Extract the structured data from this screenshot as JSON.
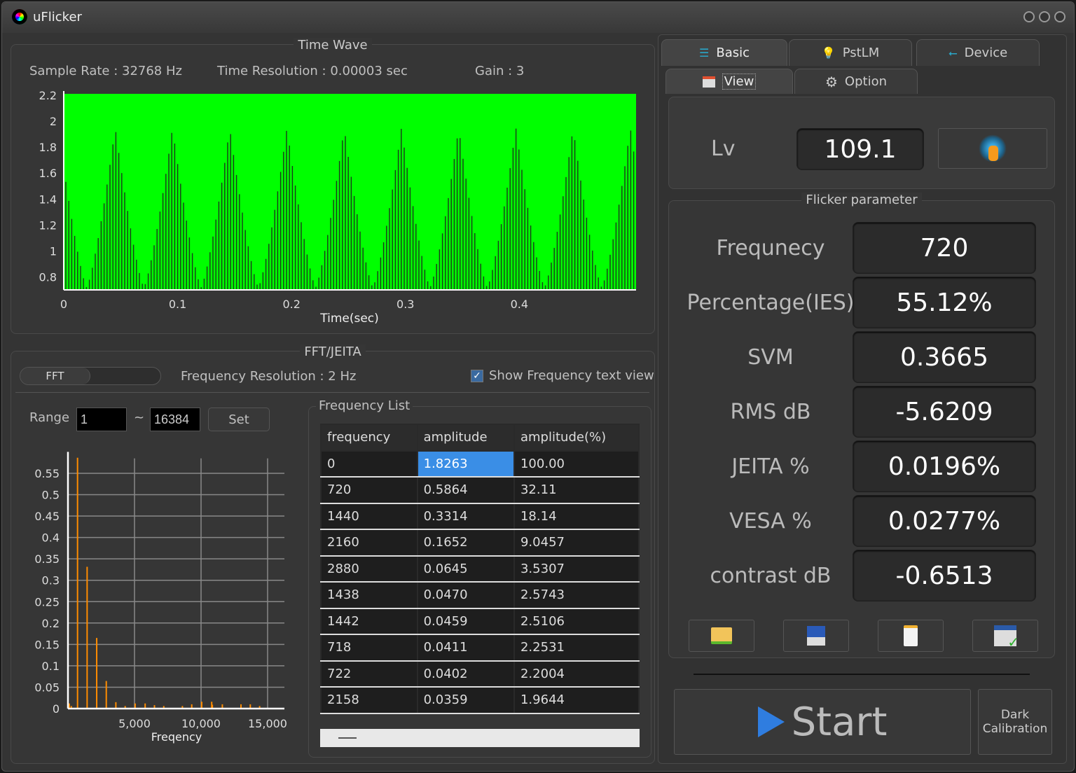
{
  "app": {
    "title": "uFlicker"
  },
  "time_wave": {
    "title": "Time Wave",
    "sample_rate": "Sample Rate : 32768 Hz",
    "time_resolution": "Time Resolution : 0.00003 sec",
    "gain": "Gain : 3"
  },
  "chart_data": [
    {
      "type": "area",
      "xlabel": "Time(sec)",
      "ylabel": "",
      "x_ticks": [
        "0",
        "0.1",
        "0.2",
        "0.3",
        "0.4"
      ],
      "y_ticks": [
        "0.8",
        "1",
        "1.2",
        "1.4",
        "1.6",
        "1.8",
        "2",
        "2.2"
      ],
      "xlim": [
        0,
        0.5
      ],
      "ylim": [
        0.7,
        2.2
      ],
      "color": "#00ff00",
      "envelope_peaks_x": [
        0.045,
        0.095,
        0.145,
        0.195,
        0.245,
        0.295,
        0.345,
        0.395,
        0.445,
        0.495
      ],
      "peak_y": 1.95,
      "max_y": 2.2,
      "min_y": 0.72
    },
    {
      "type": "bar",
      "xlabel": "Freqency",
      "ylabel": "",
      "x_ticks": [
        "5,000",
        "10,000",
        "15,000"
      ],
      "y_ticks": [
        "0",
        "0.05",
        "0.1",
        "0.15",
        "0.2",
        "0.25",
        "0.3",
        "0.35",
        "0.4",
        "0.45",
        "0.5",
        "0.55"
      ],
      "xlim": [
        0,
        16384
      ],
      "ylim": [
        0,
        0.59
      ],
      "color": "#ff8c00",
      "x": [
        100,
        250,
        720,
        1440,
        2160,
        2880,
        3600,
        4300,
        5050,
        5800,
        6500,
        7200,
        8600,
        9300,
        10050,
        10800,
        10850,
        11600,
        13000,
        13700,
        14400
      ],
      "values": [
        0.012,
        0.006,
        0.5864,
        0.3314,
        0.1652,
        0.0645,
        0.015,
        0.006,
        0.012,
        0.012,
        0.008,
        0.006,
        0.006,
        0.01,
        0.016,
        0.016,
        0.009,
        0.01,
        0.01,
        0.01,
        0.006
      ]
    }
  ],
  "fft": {
    "title": "FFT/JEITA",
    "mode_label": "FFT",
    "freq_resolution": "Frequency Resolution : 2 Hz",
    "show_text_view": "Show Frequency text view",
    "show_text_view_checked": true,
    "range_label": "Range",
    "range_from": "1",
    "range_sep": "~",
    "range_to": "16384",
    "set_label": "Set"
  },
  "freq_list": {
    "title": "Frequency List",
    "columns": [
      "frequency",
      "amplitude",
      "amplitude(%)"
    ],
    "rows": [
      [
        "0",
        "1.8263",
        "100.00"
      ],
      [
        "720",
        "0.5864",
        "32.11"
      ],
      [
        "1440",
        "0.3314",
        "18.14"
      ],
      [
        "2160",
        "0.1652",
        "9.0457"
      ],
      [
        "2880",
        "0.0645",
        "3.5307"
      ],
      [
        "1438",
        "0.0470",
        "2.5743"
      ],
      [
        "1442",
        "0.0459",
        "2.5106"
      ],
      [
        "718",
        "0.0411",
        "2.2531"
      ],
      [
        "722",
        "0.0402",
        "2.2004"
      ],
      [
        "2158",
        "0.0359",
        "1.9644"
      ]
    ]
  },
  "tabs": {
    "top": [
      {
        "label": "Basic",
        "icon": "list-icon"
      },
      {
        "label": "PstLM",
        "icon": "bulb-icon"
      },
      {
        "label": "Device",
        "icon": "usb-icon"
      }
    ],
    "sub": [
      {
        "label": "View",
        "icon": "window-icon"
      },
      {
        "label": "Option",
        "icon": "gear-icon"
      }
    ]
  },
  "lv": {
    "label": "Lv",
    "value": "109.1"
  },
  "flicker": {
    "title": "Flicker parameter",
    "params": [
      {
        "label": "Frequnecy",
        "value": "720"
      },
      {
        "label": "Percentage(IES)",
        "value": "55.12%"
      },
      {
        "label": "SVM",
        "value": "0.3665"
      },
      {
        "label": "RMS dB",
        "value": "-5.6209"
      },
      {
        "label": "JEITA %",
        "value": "0.0196%"
      },
      {
        "label": "VESA %",
        "value": "0.0277%"
      },
      {
        "label": "contrast dB",
        "value": "-0.6513"
      }
    ]
  },
  "actions": {
    "start": "Start",
    "dark_cal_1": "Dark",
    "dark_cal_2": "Calibration"
  },
  "colors": {
    "wave": "#00ff00",
    "spectrum": "#ff8c00",
    "selection": "#3a8ee6",
    "start_icon": "#2f7de0"
  }
}
